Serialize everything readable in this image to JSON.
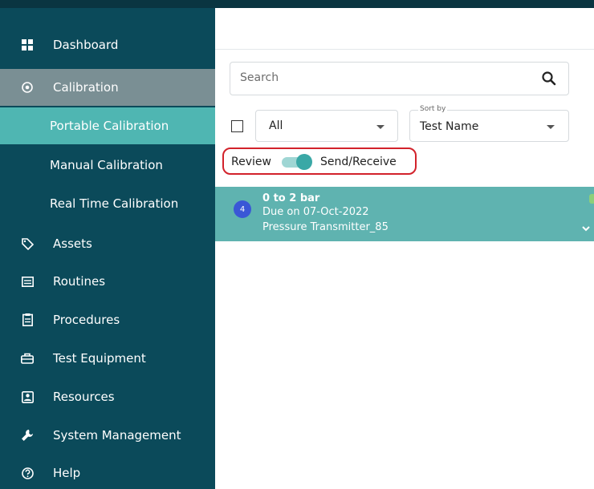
{
  "sidebar": {
    "items": [
      {
        "label": "Dashboard",
        "icon": "dashboard-icon"
      },
      {
        "label": "Calibration",
        "icon": "calibration-icon"
      },
      {
        "label": "Portable Calibration"
      },
      {
        "label": "Manual Calibration"
      },
      {
        "label": "Real Time Calibration"
      },
      {
        "label": "Assets",
        "icon": "tag-icon"
      },
      {
        "label": "Routines",
        "icon": "routines-icon"
      },
      {
        "label": "Procedures",
        "icon": "procedures-icon"
      },
      {
        "label": "Test Equipment",
        "icon": "test-equipment-icon"
      },
      {
        "label": "Resources",
        "icon": "resources-icon"
      },
      {
        "label": "System Management",
        "icon": "wrench-icon"
      },
      {
        "label": "Help",
        "icon": "help-icon"
      }
    ],
    "colors": {
      "background": "#0b4a5a",
      "active_parent": "#7a8f94",
      "active_child": "#4fb6b2"
    }
  },
  "search": {
    "placeholder": "Search",
    "value": ""
  },
  "filter": {
    "selected": "All"
  },
  "sort": {
    "label": "Sort by",
    "selected": "Test Name"
  },
  "toggle": {
    "left_label": "Review",
    "right_label": "Send/Receive",
    "state": "on",
    "accent": "#3aa8a6"
  },
  "card": {
    "badge": "4",
    "title": "0 to 2 bar",
    "due": "Due on 07-Oct-2022",
    "name": "Pressure Transmitter_85",
    "background": "#5fb3b0"
  }
}
